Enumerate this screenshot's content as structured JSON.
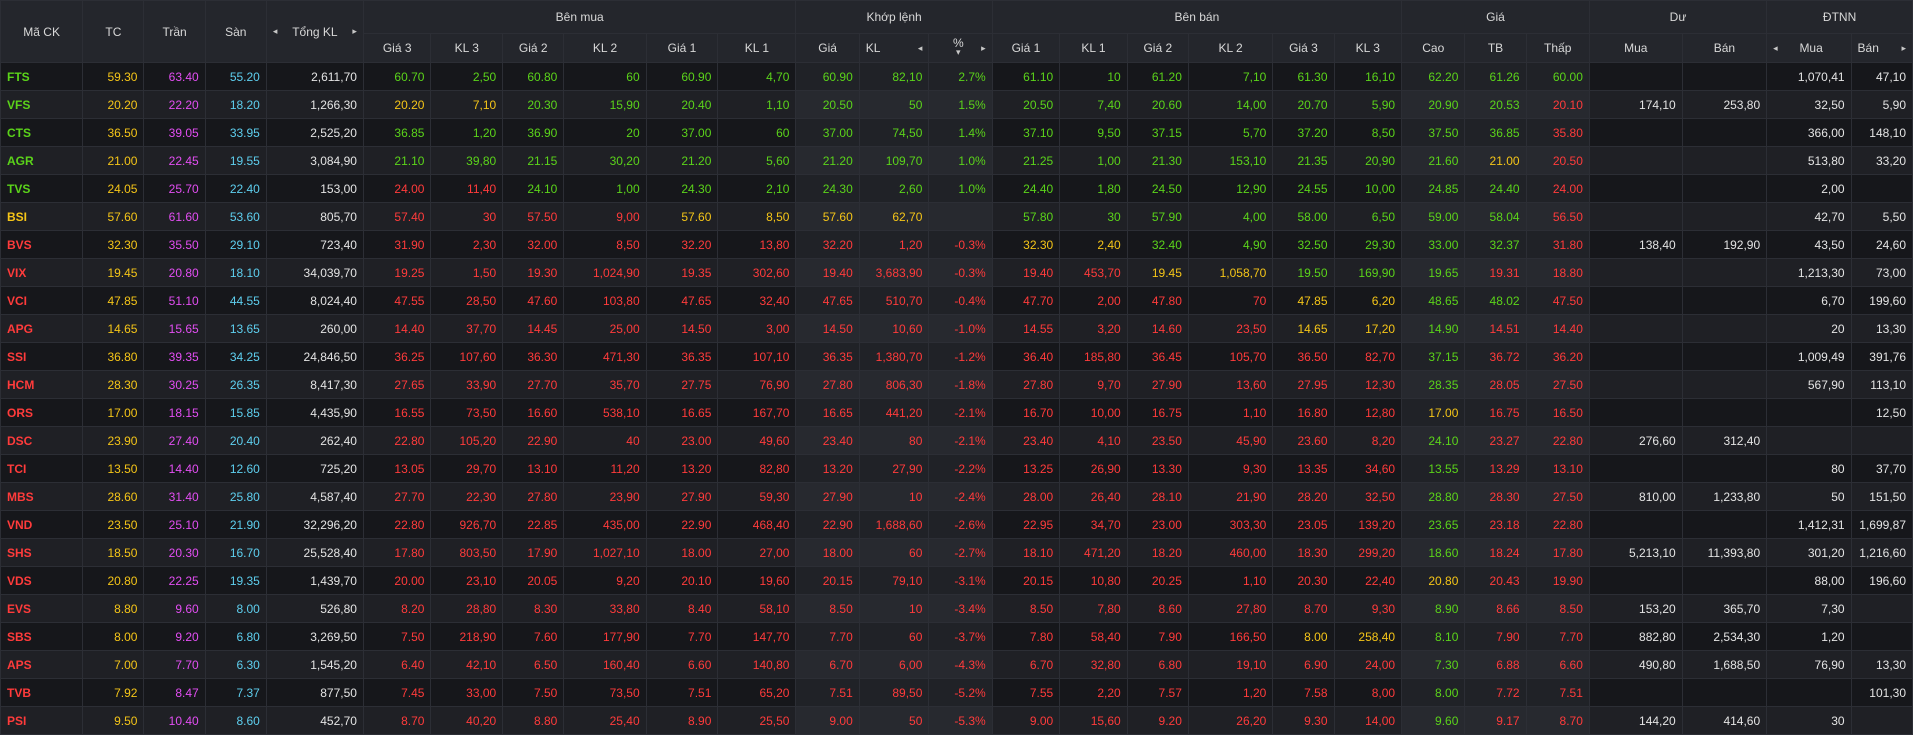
{
  "colors": {
    "up": "#5bd31a",
    "down": "#ff3b3b",
    "ref": "#f5c518",
    "ceil": "#e34ef3",
    "floor": "#5ecfef",
    "neutral": "#e4e4e4"
  },
  "headers": {
    "symbol": "Mã CK",
    "ref": "TC",
    "ceil": "Trần",
    "floor": "Sàn",
    "total_vol": "Tổng KL",
    "bid_group": "Bên mua",
    "match_group": "Khớp lệnh",
    "ask_group": "Bên bán",
    "price_group": "Giá",
    "residual_group": "Dư",
    "foreign_group": "ĐTNN",
    "bid_cols": [
      "Giá 3",
      "KL 3",
      "Giá 2",
      "KL 2",
      "Giá 1",
      "KL 1"
    ],
    "match_cols": [
      "Giá",
      "KL",
      "%"
    ],
    "ask_cols": [
      "Giá 1",
      "KL 1",
      "Giá 2",
      "KL 2",
      "Giá 3",
      "KL 3"
    ],
    "price_cols": [
      "Cao",
      "TB",
      "Thấp"
    ],
    "residual_cols": [
      "Mua",
      "Bán"
    ],
    "foreign_cols": [
      "Mua",
      "Bán"
    ],
    "prev_arrow": "◂",
    "next_arrow": "▸",
    "sort_arrow": "▾"
  },
  "rows": [
    [
      "FTS",
      "59.30",
      "63.40",
      "55.20",
      "2,611,70",
      "60.70",
      "2,50",
      "60.80",
      "60",
      "60.90",
      "4,70",
      "60.90",
      "82,10",
      "2.7%",
      "61.10",
      "10",
      "61.20",
      "7,10",
      "61.30",
      "16,10",
      "62.20",
      "61.26",
      "60.00",
      "",
      "",
      "1,070,41",
      "47,10"
    ],
    [
      "VFS",
      "20.20",
      "22.20",
      "18.20",
      "1,266,30",
      "20.20",
      "7,10",
      "20.30",
      "15,90",
      "20.40",
      "1,10",
      "20.50",
      "50",
      "1.5%",
      "20.50",
      "7,40",
      "20.60",
      "14,00",
      "20.70",
      "5,90",
      "20.90",
      "20.53",
      "20.10",
      "174,10",
      "253,80",
      "32,50",
      "5,90"
    ],
    [
      "CTS",
      "36.50",
      "39.05",
      "33.95",
      "2,525,20",
      "36.85",
      "1,20",
      "36.90",
      "20",
      "37.00",
      "60",
      "37.00",
      "74,50",
      "1.4%",
      "37.10",
      "9,50",
      "37.15",
      "5,70",
      "37.20",
      "8,50",
      "37.50",
      "36.85",
      "35.80",
      "",
      "",
      "366,00",
      "148,10"
    ],
    [
      "AGR",
      "21.00",
      "22.45",
      "19.55",
      "3,084,90",
      "21.10",
      "39,80",
      "21.15",
      "30,20",
      "21.20",
      "5,60",
      "21.20",
      "109,70",
      "1.0%",
      "21.25",
      "1,00",
      "21.30",
      "153,10",
      "21.35",
      "20,90",
      "21.60",
      "21.00",
      "20.50",
      "",
      "",
      "513,80",
      "33,20"
    ],
    [
      "TVS",
      "24.05",
      "25.70",
      "22.40",
      "153,00",
      "24.00",
      "11,40",
      "24.10",
      "1,00",
      "24.30",
      "2,10",
      "24.30",
      "2,60",
      "1.0%",
      "24.40",
      "1,80",
      "24.50",
      "12,90",
      "24.55",
      "10,00",
      "24.85",
      "24.40",
      "24.00",
      "",
      "",
      "2,00",
      ""
    ],
    [
      "BSI",
      "57.60",
      "61.60",
      "53.60",
      "805,70",
      "57.40",
      "30",
      "57.50",
      "9,00",
      "57.60",
      "8,50",
      "57.60",
      "62,70",
      "",
      "57.80",
      "30",
      "57.90",
      "4,00",
      "58.00",
      "6,50",
      "59.00",
      "58.04",
      "56.50",
      "",
      "",
      "42,70",
      "5,50"
    ],
    [
      "BVS",
      "32.30",
      "35.50",
      "29.10",
      "723,40",
      "31.90",
      "2,30",
      "32.00",
      "8,50",
      "32.20",
      "13,80",
      "32.20",
      "1,20",
      "-0.3%",
      "32.30",
      "2,40",
      "32.40",
      "4,90",
      "32.50",
      "29,30",
      "33.00",
      "32.37",
      "31.80",
      "138,40",
      "192,90",
      "43,50",
      "24,60"
    ],
    [
      "VIX",
      "19.45",
      "20.80",
      "18.10",
      "34,039,70",
      "19.25",
      "1,50",
      "19.30",
      "1,024,90",
      "19.35",
      "302,60",
      "19.40",
      "3,683,90",
      "-0.3%",
      "19.40",
      "453,70",
      "19.45",
      "1,058,70",
      "19.50",
      "169,90",
      "19.65",
      "19.31",
      "18.80",
      "",
      "",
      "1,213,30",
      "73,00"
    ],
    [
      "VCI",
      "47.85",
      "51.10",
      "44.55",
      "8,024,40",
      "47.55",
      "28,50",
      "47.60",
      "103,80",
      "47.65",
      "32,40",
      "47.65",
      "510,70",
      "-0.4%",
      "47.70",
      "2,00",
      "47.80",
      "70",
      "47.85",
      "6,20",
      "48.65",
      "48.02",
      "47.50",
      "",
      "",
      "6,70",
      "199,60"
    ],
    [
      "APG",
      "14.65",
      "15.65",
      "13.65",
      "260,00",
      "14.40",
      "37,70",
      "14.45",
      "25,00",
      "14.50",
      "3,00",
      "14.50",
      "10,60",
      "-1.0%",
      "14.55",
      "3,20",
      "14.60",
      "23,50",
      "14.65",
      "17,20",
      "14.90",
      "14.51",
      "14.40",
      "",
      "",
      "20",
      "13,30"
    ],
    [
      "SSI",
      "36.80",
      "39.35",
      "34.25",
      "24,846,50",
      "36.25",
      "107,60",
      "36.30",
      "471,30",
      "36.35",
      "107,10",
      "36.35",
      "1,380,70",
      "-1.2%",
      "36.40",
      "185,80",
      "36.45",
      "105,70",
      "36.50",
      "82,70",
      "37.15",
      "36.72",
      "36.20",
      "",
      "",
      "1,009,49",
      "391,76"
    ],
    [
      "HCM",
      "28.30",
      "30.25",
      "26.35",
      "8,417,30",
      "27.65",
      "33,90",
      "27.70",
      "35,70",
      "27.75",
      "76,90",
      "27.80",
      "806,30",
      "-1.8%",
      "27.80",
      "9,70",
      "27.90",
      "13,60",
      "27.95",
      "12,30",
      "28.35",
      "28.05",
      "27.50",
      "",
      "",
      "567,90",
      "113,10"
    ],
    [
      "ORS",
      "17.00",
      "18.15",
      "15.85",
      "4,435,90",
      "16.55",
      "73,50",
      "16.60",
      "538,10",
      "16.65",
      "167,70",
      "16.65",
      "441,20",
      "-2.1%",
      "16.70",
      "10,00",
      "16.75",
      "1,10",
      "16.80",
      "12,80",
      "17.00",
      "16.75",
      "16.50",
      "",
      "",
      "",
      "12,50"
    ],
    [
      "DSC",
      "23.90",
      "27.40",
      "20.40",
      "262,40",
      "22.80",
      "105,20",
      "22.90",
      "40",
      "23.00",
      "49,60",
      "23.40",
      "80",
      "-2.1%",
      "23.40",
      "4,10",
      "23.50",
      "45,90",
      "23.60",
      "8,20",
      "24.10",
      "23.27",
      "22.80",
      "276,60",
      "312,40",
      "",
      ""
    ],
    [
      "TCI",
      "13.50",
      "14.40",
      "12.60",
      "725,20",
      "13.05",
      "29,70",
      "13.10",
      "11,20",
      "13.20",
      "82,80",
      "13.20",
      "27,90",
      "-2.2%",
      "13.25",
      "26,90",
      "13.30",
      "9,30",
      "13.35",
      "34,60",
      "13.55",
      "13.29",
      "13.10",
      "",
      "",
      "80",
      "37,70"
    ],
    [
      "MBS",
      "28.60",
      "31.40",
      "25.80",
      "4,587,40",
      "27.70",
      "22,30",
      "27.80",
      "23,90",
      "27.90",
      "59,30",
      "27.90",
      "10",
      "-2.4%",
      "28.00",
      "26,40",
      "28.10",
      "21,90",
      "28.20",
      "32,50",
      "28.80",
      "28.30",
      "27.50",
      "810,00",
      "1,233,80",
      "50",
      "151,50"
    ],
    [
      "VND",
      "23.50",
      "25.10",
      "21.90",
      "32,296,20",
      "22.80",
      "926,70",
      "22.85",
      "435,00",
      "22.90",
      "468,40",
      "22.90",
      "1,688,60",
      "-2.6%",
      "22.95",
      "34,70",
      "23.00",
      "303,30",
      "23.05",
      "139,20",
      "23.65",
      "23.18",
      "22.80",
      "",
      "",
      "1,412,31",
      "1,699,87"
    ],
    [
      "SHS",
      "18.50",
      "20.30",
      "16.70",
      "25,528,40",
      "17.80",
      "803,50",
      "17.90",
      "1,027,10",
      "18.00",
      "27,00",
      "18.00",
      "60",
      "-2.7%",
      "18.10",
      "471,20",
      "18.20",
      "460,00",
      "18.30",
      "299,20",
      "18.60",
      "18.24",
      "17.80",
      "5,213,10",
      "11,393,80",
      "301,20",
      "1,216,60"
    ],
    [
      "VDS",
      "20.80",
      "22.25",
      "19.35",
      "1,439,70",
      "20.00",
      "23,10",
      "20.05",
      "9,20",
      "20.10",
      "19,60",
      "20.15",
      "79,10",
      "-3.1%",
      "20.15",
      "10,80",
      "20.25",
      "1,10",
      "20.30",
      "22,40",
      "20.80",
      "20.43",
      "19.90",
      "",
      "",
      "88,00",
      "196,60"
    ],
    [
      "EVS",
      "8.80",
      "9.60",
      "8.00",
      "526,80",
      "8.20",
      "28,80",
      "8.30",
      "33,80",
      "8.40",
      "58,10",
      "8.50",
      "10",
      "-3.4%",
      "8.50",
      "7,80",
      "8.60",
      "27,80",
      "8.70",
      "9,30",
      "8.90",
      "8.66",
      "8.50",
      "153,20",
      "365,70",
      "7,30",
      ""
    ],
    [
      "SBS",
      "8.00",
      "9.20",
      "6.80",
      "3,269,50",
      "7.50",
      "218,90",
      "7.60",
      "177,90",
      "7.70",
      "147,70",
      "7.70",
      "60",
      "-3.7%",
      "7.80",
      "58,40",
      "7.90",
      "166,50",
      "8.00",
      "258,40",
      "8.10",
      "7.90",
      "7.70",
      "882,80",
      "2,534,30",
      "1,20",
      ""
    ],
    [
      "APS",
      "7.00",
      "7.70",
      "6.30",
      "1,545,20",
      "6.40",
      "42,10",
      "6.50",
      "160,40",
      "6.60",
      "140,80",
      "6.70",
      "6,00",
      "-4.3%",
      "6.70",
      "32,80",
      "6.80",
      "19,10",
      "6.90",
      "24,00",
      "7.30",
      "6.88",
      "6.60",
      "490,80",
      "1,688,50",
      "76,90",
      "13,30"
    ],
    [
      "TVB",
      "7.92",
      "8.47",
      "7.37",
      "877,50",
      "7.45",
      "33,00",
      "7.50",
      "73,50",
      "7.51",
      "65,20",
      "7.51",
      "89,50",
      "-5.2%",
      "7.55",
      "2,20",
      "7.57",
      "1,20",
      "7.58",
      "8,00",
      "8.00",
      "7.72",
      "7.51",
      "",
      "",
      "",
      "101,30"
    ],
    [
      "PSI",
      "9.50",
      "10.40",
      "8.60",
      "452,70",
      "8.70",
      "40,20",
      "8.80",
      "25,40",
      "8.90",
      "25,50",
      "9.00",
      "50",
      "-5.3%",
      "9.00",
      "15,60",
      "9.20",
      "26,20",
      "9.30",
      "14,00",
      "9.60",
      "9.17",
      "8.70",
      "144,20",
      "414,60",
      "30",
      ""
    ]
  ]
}
